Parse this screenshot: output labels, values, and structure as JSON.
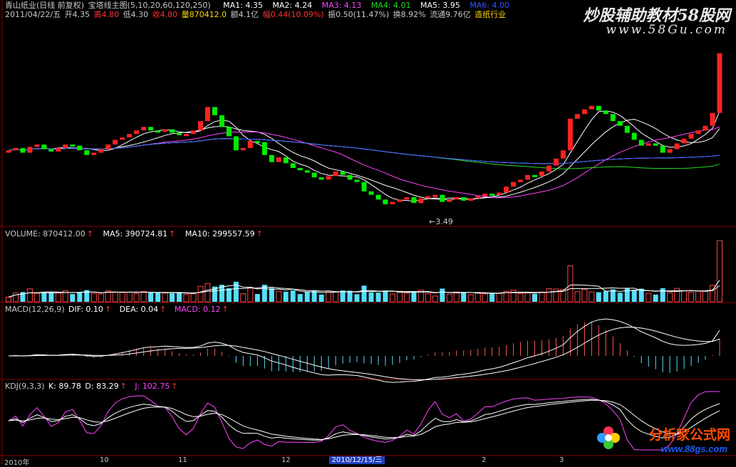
{
  "title_line": {
    "stock": "青山纸业(日线 前复权)",
    "indicator": "宝塔线主图(5,10,20,60,120,250)",
    "ma": [
      {
        "label": "MA1: 4.35",
        "color": "#ffffff"
      },
      {
        "label": "MA2: 4.24",
        "color": "#ffffff"
      },
      {
        "label": "MA3: 4.13",
        "color": "#ff44ff"
      },
      {
        "label": "MA4: 4.01",
        "color": "#22dd22"
      },
      {
        "label": "MA5: 3.95",
        "color": "#ffffff"
      },
      {
        "label": "MA6: 4.00",
        "color": "#3355ff"
      }
    ]
  },
  "info_line": {
    "date": "2011/04/22/五",
    "open": "开4.35",
    "high": "高4.80",
    "low": "低4.30",
    "close": "收4.80",
    "volume": "量870412.0",
    "amount": "额4.1亿",
    "change": "幅0.44(10.09%)",
    "amplitude": "振0.50(11.47%)",
    "turnover": "换8.92%",
    "float": "流通9.76亿",
    "industry": "造纸行业"
  },
  "price_annotation": "←3.49",
  "volume_header": {
    "vol": "VOLUME: 870412.00",
    "ma5": "MA5: 390724.81",
    "ma10": "MA10: 299557.59"
  },
  "macd_header": {
    "name": "MACD(12,26,9)",
    "dif": "DIF: 0.10",
    "dea": "DEA: 0.04",
    "macd": "MACD: 0.12"
  },
  "kdj_header": {
    "name": "KDJ(9,3,3)",
    "k": "K: 89.78",
    "d": "D: 83.29",
    "j": "J: 102.75"
  },
  "x_axis": {
    "labels": [
      "2010年",
      "10",
      "11",
      "12",
      "2010/12/15/三",
      "2",
      "3"
    ]
  },
  "watermarks": {
    "top1": "炒股辅助教材58股网",
    "top2": "www.58Gu.com",
    "bottom1": "分析家公式网",
    "bottom2": "www.88gs.com"
  },
  "chart_data": {
    "type": "candlestick",
    "title": "青山纸业(日线 前复权)",
    "min_price": 3.49,
    "last_close": 4.8,
    "closes": [
      3.97,
      3.99,
      3.95,
      4.0,
      4.02,
      3.98,
      3.96,
      3.99,
      4.02,
      4.01,
      3.97,
      3.93,
      3.95,
      3.98,
      4.02,
      4.06,
      4.08,
      4.11,
      4.14,
      4.17,
      4.14,
      4.13,
      4.15,
      4.12,
      4.1,
      4.11,
      4.14,
      4.22,
      4.34,
      4.27,
      4.17,
      4.09,
      3.97,
      3.99,
      4.05,
      4.04,
      3.93,
      3.87,
      3.91,
      3.86,
      3.82,
      3.8,
      3.78,
      3.74,
      3.72,
      3.75,
      3.79,
      3.76,
      3.72,
      3.7,
      3.62,
      3.59,
      3.55,
      3.51,
      3.53,
      3.55,
      3.57,
      3.52,
      3.56,
      3.58,
      3.59,
      3.53,
      3.55,
      3.57,
      3.54,
      3.56,
      3.58,
      3.6,
      3.59,
      3.61,
      3.66,
      3.7,
      3.72,
      3.76,
      3.75,
      3.79,
      3.84,
      3.9,
      3.97,
      4.24,
      4.28,
      4.32,
      4.35,
      4.31,
      4.28,
      4.22,
      4.18,
      4.12,
      4.06,
      4.01,
      4.03,
      4.01,
      3.95,
      3.98,
      4.03,
      4.07,
      4.11,
      4.14,
      4.18,
      4.29,
      4.8
    ],
    "volume": {
      "last": 870412.0,
      "ma5": 390724.81,
      "ma10": 299557.59
    },
    "macd": {
      "dif": 0.1,
      "dea": 0.04,
      "macd": 0.12
    },
    "kdj": {
      "k": 89.78,
      "d": 83.29,
      "j": 102.75
    }
  }
}
